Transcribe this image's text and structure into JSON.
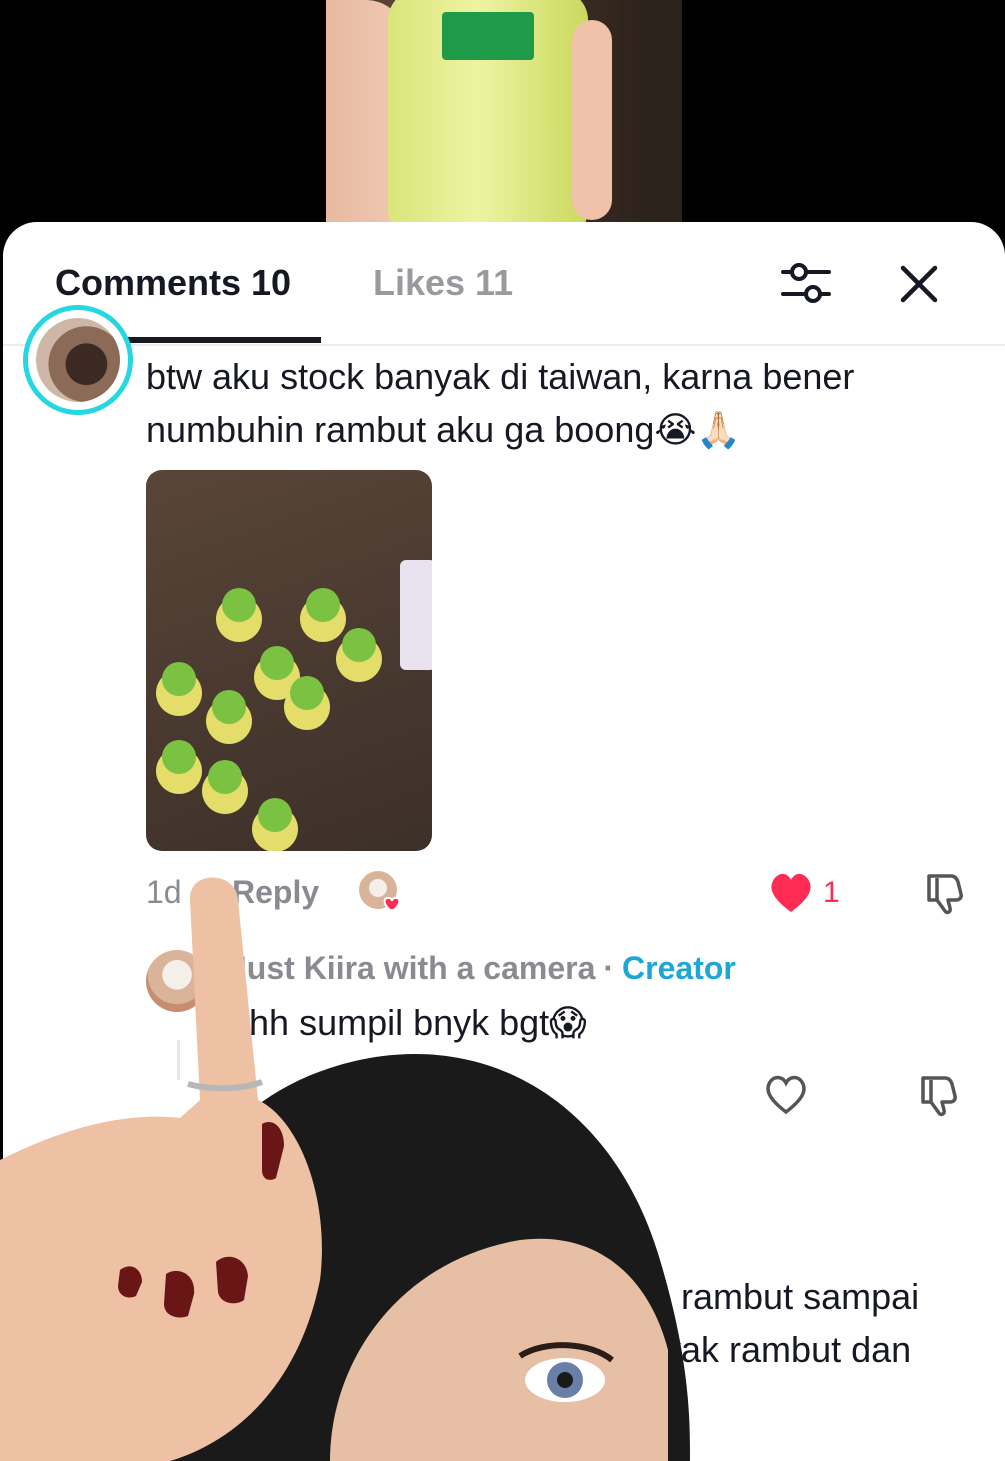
{
  "tabs": {
    "comments_label": "Comments 10",
    "likes_label": "Likes 11"
  },
  "icons": {
    "filter": "sliders-icon",
    "close": "close-icon",
    "like": "heart-icon",
    "dislike": "thumbs-down-icon",
    "creator_liked": "creator-liked-avatar-icon"
  },
  "comment": {
    "text": "btw aku stock banyak di taiwan, karna bener numbuhin rambut aku ga boong😭🙏🏻",
    "date": "1d",
    "reply_label": "Reply",
    "like_count": "1"
  },
  "reply": {
    "author": "Just Kiira with a camera",
    "separator": "·",
    "badge": "Creator",
    "text": "ahh sumpil bnyk bgt😱"
  },
  "next_comment": {
    "line1": "in rambut sampai",
    "line2": "nyak rambut dan"
  },
  "colors": {
    "accent_like": "#fe2c55",
    "creator_badge": "#1ea6d6",
    "avatar_ring": "#25d7e0"
  }
}
